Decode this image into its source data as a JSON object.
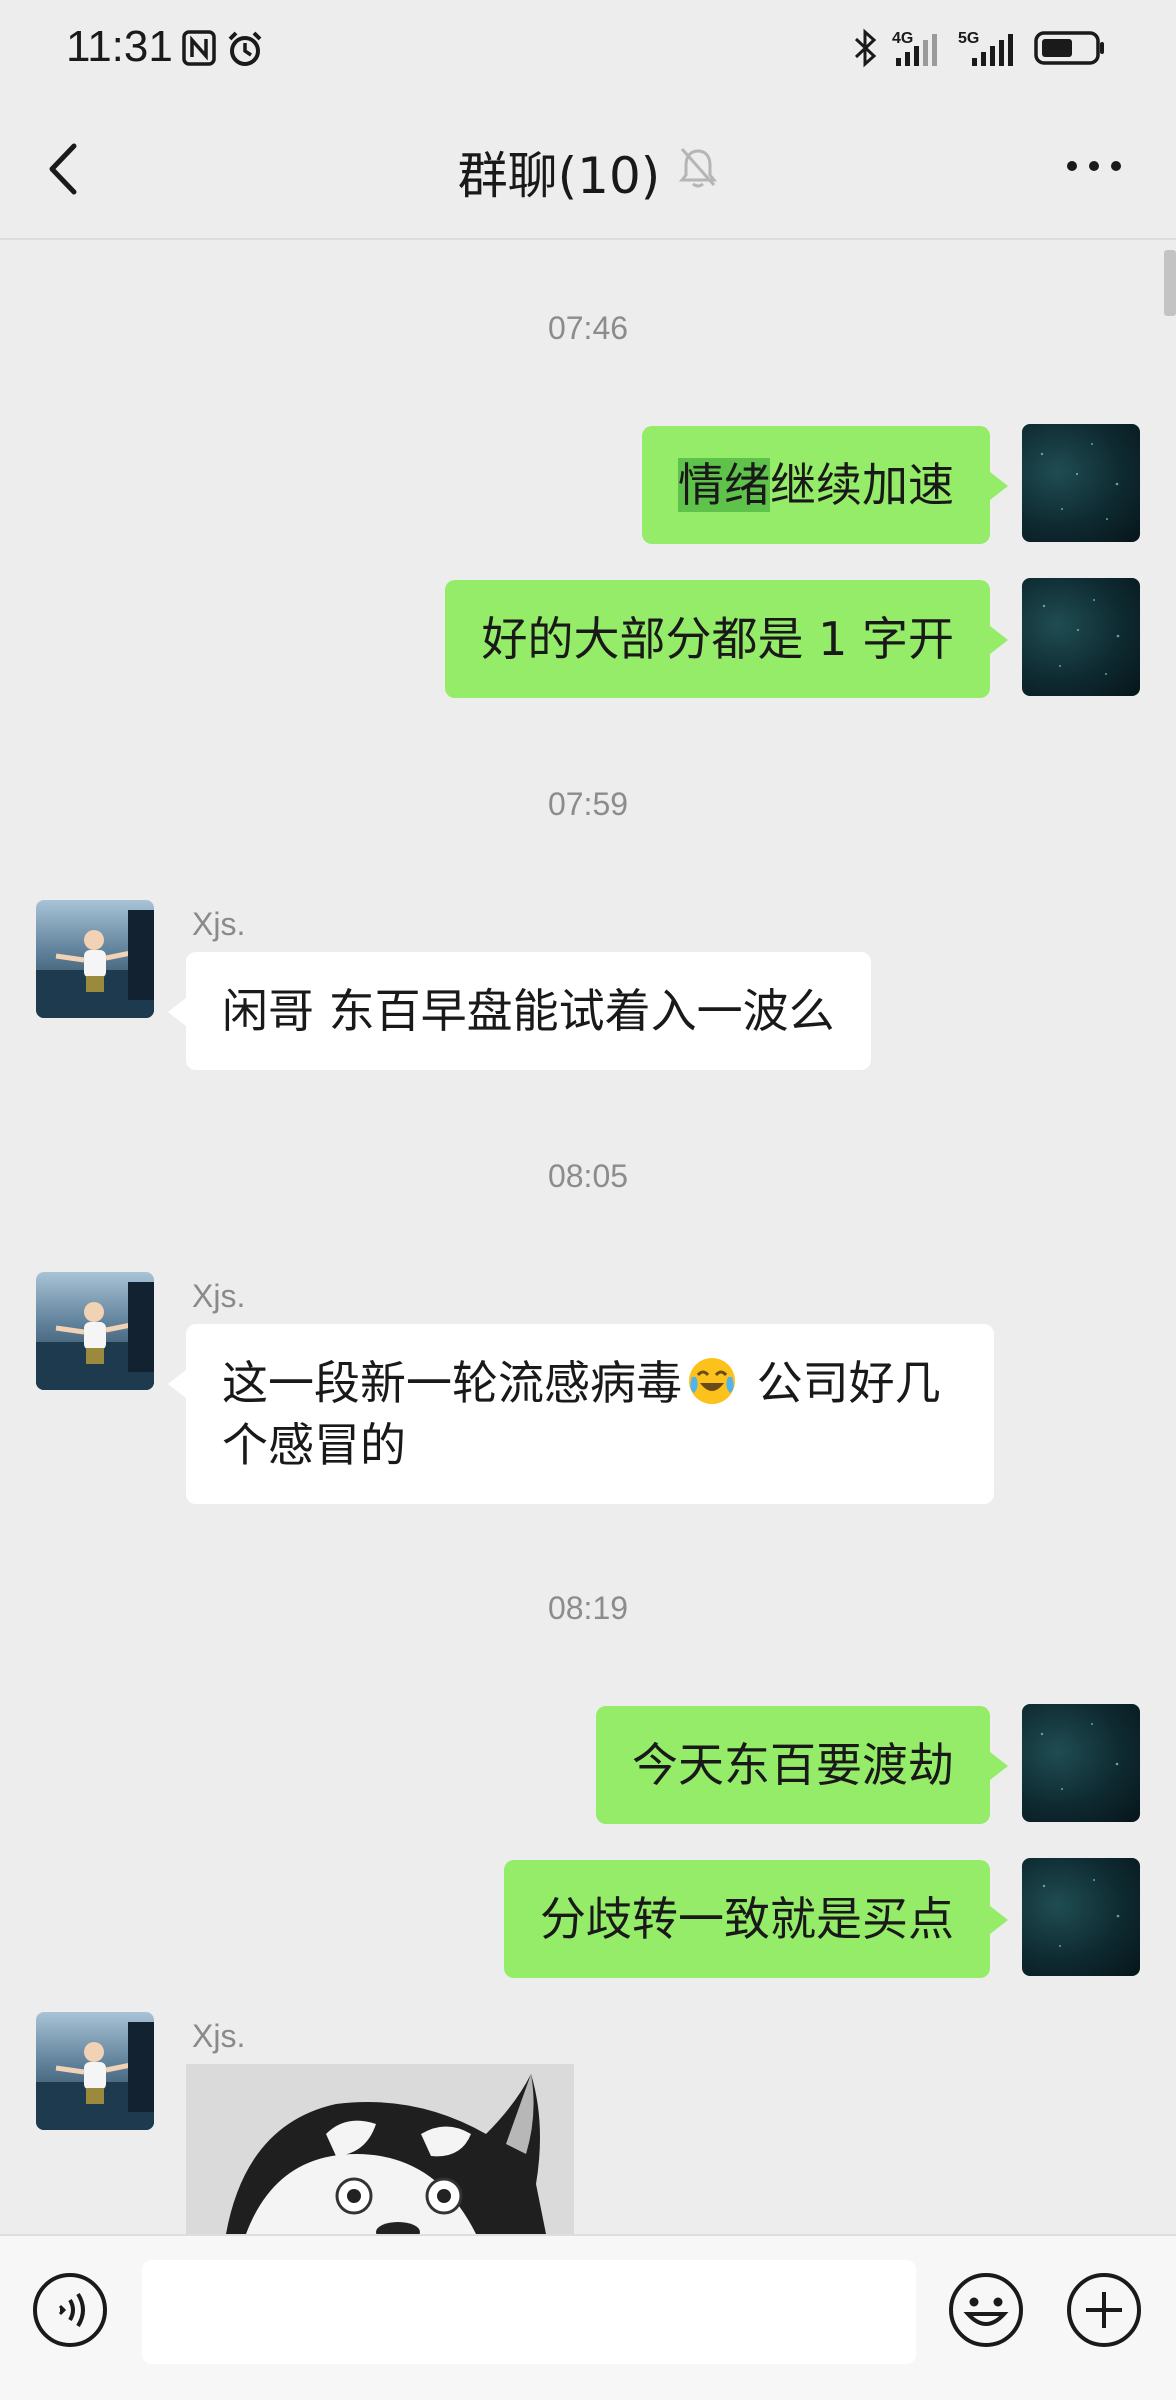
{
  "status_bar": {
    "time": "11:31",
    "icons": [
      "nfc-icon",
      "alarm-icon",
      "bluetooth-icon",
      "signal-4g-icon",
      "signal-5g-icon",
      "battery-icon"
    ],
    "network_1": "4G",
    "network_2": "5G"
  },
  "header": {
    "title": "群聊(10)",
    "muted": true,
    "icons": [
      "back-icon",
      "mute-bell-icon",
      "more-icon"
    ]
  },
  "messages": [
    {
      "type": "time",
      "text": "07:46"
    },
    {
      "type": "text",
      "from": "self",
      "text_highlighted": "情绪",
      "text_rest": "继续加速"
    },
    {
      "type": "text",
      "from": "self",
      "text": "好的大部分都是 1 字开"
    },
    {
      "type": "time",
      "text": "07:59"
    },
    {
      "type": "text",
      "from": "Xjs.",
      "text": "闲哥 东百早盘能试着入一波么"
    },
    {
      "type": "time",
      "text": "08:05"
    },
    {
      "type": "text",
      "from": "Xjs.",
      "text_before_emoji": "这一段新一轮流感病毒",
      "emoji": "crying-laughing-emoji",
      "text_after_emoji": " 公司好几",
      "text_line2": "个感冒的"
    },
    {
      "type": "time",
      "text": "08:19"
    },
    {
      "type": "text",
      "from": "self",
      "text": "今天东百要渡劫"
    },
    {
      "type": "text",
      "from": "self",
      "text": "分歧转一致就是买点"
    },
    {
      "type": "sticker",
      "from": "Xjs.",
      "sticker": "husky-sticker"
    }
  ],
  "sender_name": "Xjs.",
  "input_bar": {
    "value": "",
    "icons": [
      "voice-icon",
      "emoji-icon",
      "plus-icon"
    ]
  },
  "colors": {
    "background": "#ededed",
    "self_bubble": "#95ec69",
    "other_bubble": "#ffffff",
    "timestamp": "#8c8c8c"
  }
}
